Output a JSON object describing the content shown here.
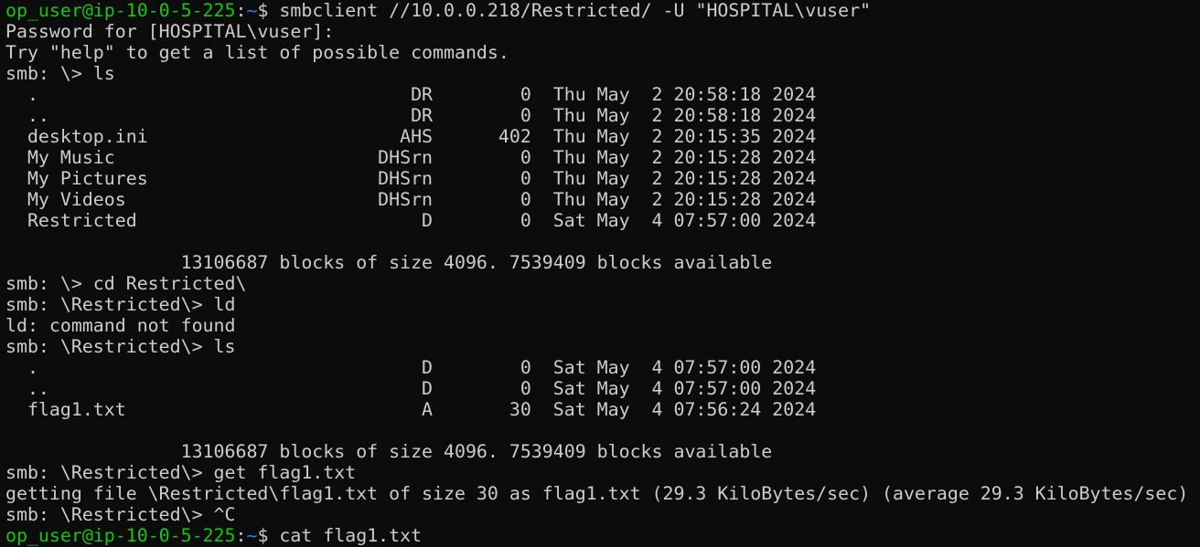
{
  "colors": {
    "background": "#0c0c0c",
    "foreground": "#cccccc",
    "prompt_user": "#16c60c",
    "prompt_path": "#3b78ff"
  },
  "terminal": {
    "lines": [
      {
        "type": "prompt",
        "user": "op_user@ip-10-0-5-225",
        "sep": ":",
        "path": "~",
        "symbol": "$ ",
        "cmd": "smbclient //10.0.0.218/Restricted/ -U \"HOSPITAL\\vuser\""
      },
      {
        "type": "text",
        "text": "Password for [HOSPITAL\\vuser]:"
      },
      {
        "type": "text",
        "text": "Try \"help\" to get a list of possible commands."
      },
      {
        "type": "text",
        "text": "smb: \\> ls"
      },
      {
        "type": "text",
        "text": "  .                                  DR        0  Thu May  2 20:58:18 2024"
      },
      {
        "type": "text",
        "text": "  ..                                 DR        0  Thu May  2 20:58:18 2024"
      },
      {
        "type": "text",
        "text": "  desktop.ini                       AHS      402  Thu May  2 20:15:35 2024"
      },
      {
        "type": "text",
        "text": "  My Music                        DHSrn        0  Thu May  2 20:15:28 2024"
      },
      {
        "type": "text",
        "text": "  My Pictures                     DHSrn        0  Thu May  2 20:15:28 2024"
      },
      {
        "type": "text",
        "text": "  My Videos                       DHSrn        0  Thu May  2 20:15:28 2024"
      },
      {
        "type": "text",
        "text": "  Restricted                          D        0  Sat May  4 07:57:00 2024"
      },
      {
        "type": "text",
        "text": ""
      },
      {
        "type": "text",
        "text": "                13106687 blocks of size 4096. 7539409 blocks available"
      },
      {
        "type": "text",
        "text": "smb: \\> cd Restricted\\"
      },
      {
        "type": "text",
        "text": "smb: \\Restricted\\> ld"
      },
      {
        "type": "text",
        "text": "ld: command not found"
      },
      {
        "type": "text",
        "text": "smb: \\Restricted\\> ls"
      },
      {
        "type": "text",
        "text": "  .                                   D        0  Sat May  4 07:57:00 2024"
      },
      {
        "type": "text",
        "text": "  ..                                  D        0  Sat May  4 07:57:00 2024"
      },
      {
        "type": "text",
        "text": "  flag1.txt                           A       30  Sat May  4 07:56:24 2024"
      },
      {
        "type": "text",
        "text": ""
      },
      {
        "type": "text",
        "text": "                13106687 blocks of size 4096. 7539409 blocks available"
      },
      {
        "type": "text",
        "text": "smb: \\Restricted\\> get flag1.txt"
      },
      {
        "type": "text",
        "text": "getting file \\Restricted\\flag1.txt of size 30 as flag1.txt (29.3 KiloBytes/sec) (average 29.3 KiloBytes/sec)"
      },
      {
        "type": "text",
        "text": "smb: \\Restricted\\> ^C"
      },
      {
        "type": "prompt",
        "user": "op_user@ip-10-0-5-225",
        "sep": ":",
        "path": "~",
        "symbol": "$ ",
        "cmd": "cat flag1.txt"
      }
    ]
  }
}
